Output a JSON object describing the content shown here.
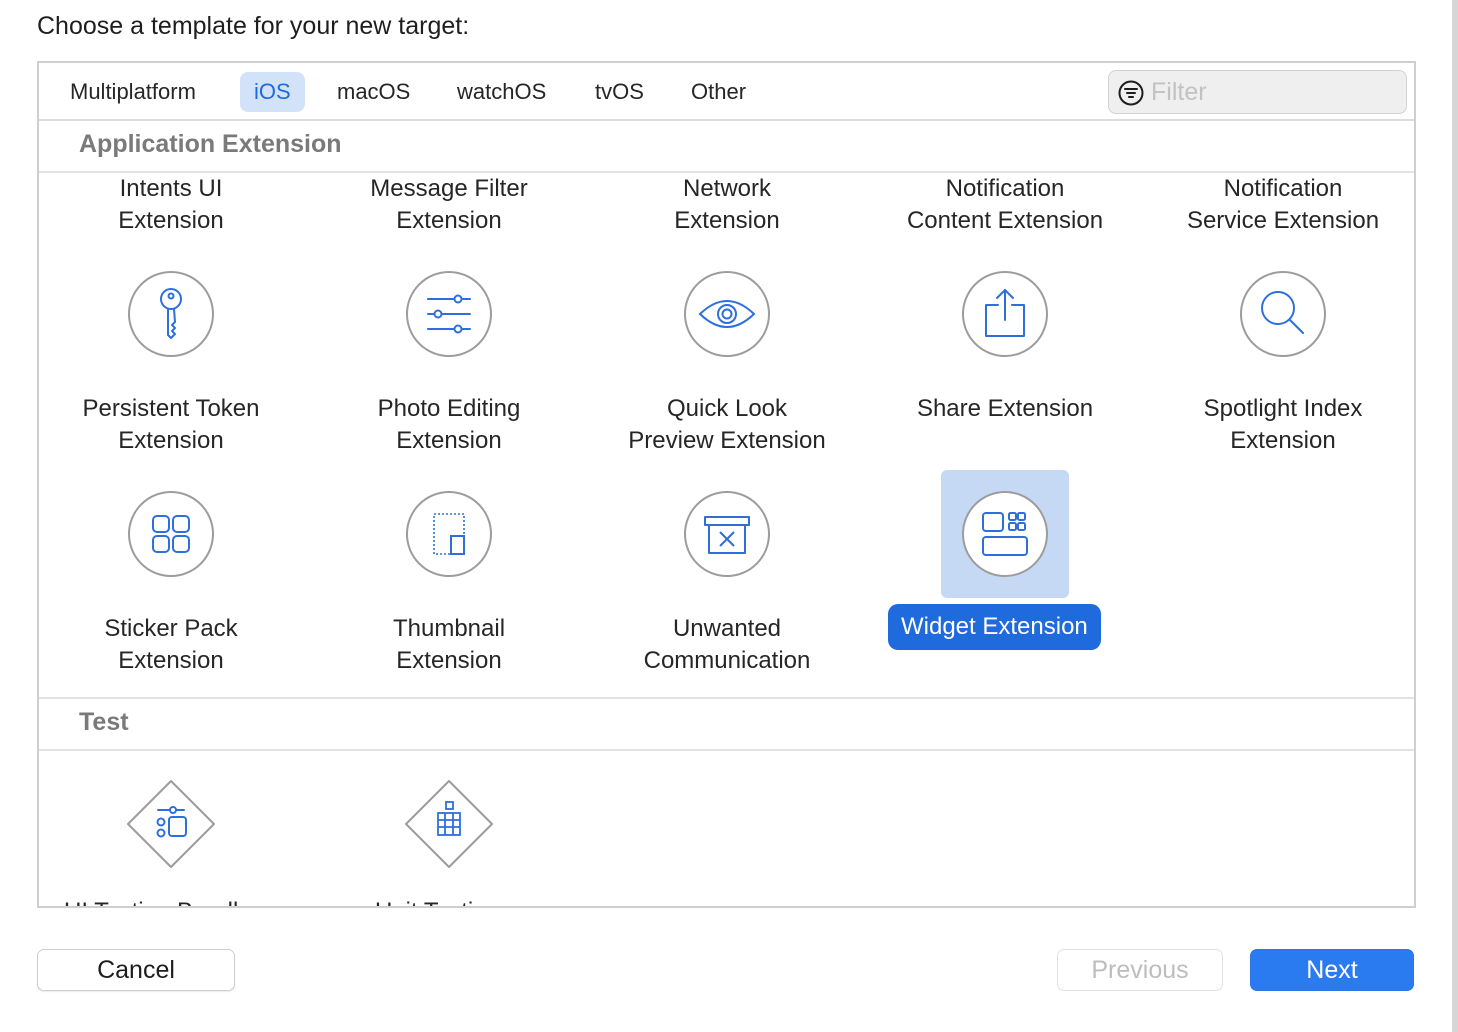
{
  "heading": "Choose a template for your new target:",
  "tabs": [
    {
      "label": "Multiplatform",
      "active": false
    },
    {
      "label": "iOS",
      "active": true
    },
    {
      "label": "macOS",
      "active": false
    },
    {
      "label": "watchOS",
      "active": false
    },
    {
      "label": "tvOS",
      "active": false
    },
    {
      "label": "Other",
      "active": false
    }
  ],
  "filter": {
    "placeholder": "Filter",
    "value": ""
  },
  "sections": {
    "application_extension": {
      "title": "Application Extension",
      "partial_row_labels": [
        {
          "line1": "Intents UI",
          "line2": "Extension"
        },
        {
          "line1": "Message Filter",
          "line2": "Extension"
        },
        {
          "line1": "Network",
          "line2": "Extension"
        },
        {
          "line1": "Notification",
          "line2": "Content Extension"
        },
        {
          "line1": "Notification",
          "line2": "Service Extension"
        }
      ],
      "templates": [
        {
          "icon": "key-icon",
          "line1": "Persistent Token",
          "line2": "Extension"
        },
        {
          "icon": "sliders-icon",
          "line1": "Photo Editing",
          "line2": "Extension"
        },
        {
          "icon": "eye-icon",
          "line1": "Quick Look",
          "line2": "Preview Extension"
        },
        {
          "icon": "share-icon",
          "line1": "Share Extension",
          "line2": ""
        },
        {
          "icon": "magnifier-icon",
          "line1": "Spotlight Index",
          "line2": "Extension"
        },
        {
          "icon": "sticker-grid-icon",
          "line1": "Sticker Pack",
          "line2": "Extension"
        },
        {
          "icon": "thumbnail-icon",
          "line1": "Thumbnail",
          "line2": "Extension"
        },
        {
          "icon": "junk-box-icon",
          "line1": "Unwanted",
          "line2": "Communication"
        },
        {
          "icon": "widget-icon",
          "line1": "Widget Extension",
          "line2": "",
          "selected": true
        }
      ]
    },
    "test": {
      "title": "Test",
      "templates": [
        {
          "icon": "ui-testing-icon",
          "label_clipped": "UI Testing Bundle"
        },
        {
          "icon": "unit-testing-icon",
          "label_clipped": "Unit Testing Bundle"
        }
      ]
    }
  },
  "buttons": {
    "cancel": "Cancel",
    "previous": "Previous",
    "next": "Next"
  },
  "colors": {
    "accent": "#1f6adc",
    "selection_tile": "#c6d9f4",
    "icon_stroke": "#2f6fdc"
  }
}
